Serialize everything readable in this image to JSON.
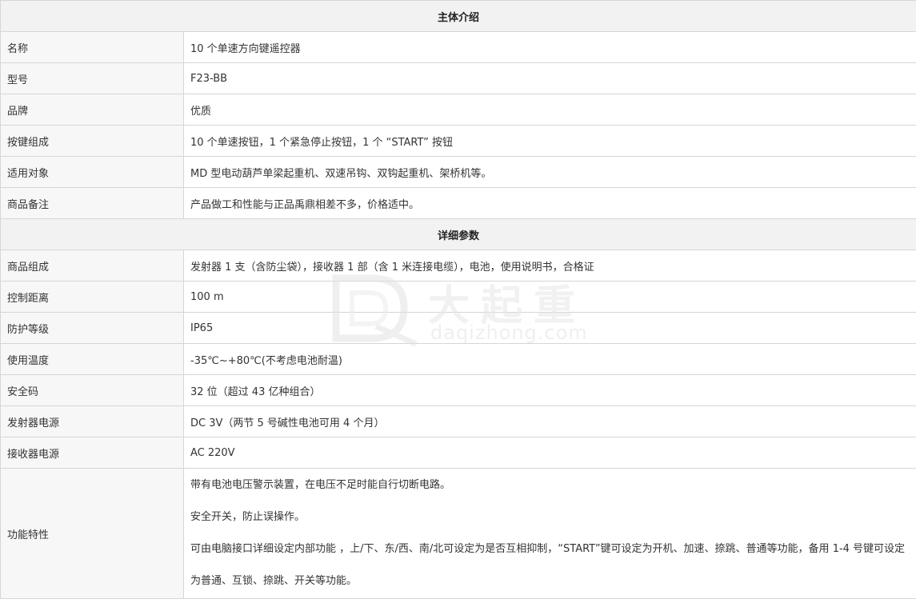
{
  "sections": [
    {
      "title": "主体介绍",
      "rows": [
        {
          "label": "名称",
          "value": "10 个单速方向键遥控器"
        },
        {
          "label": "型号",
          "value": "F23-BB"
        },
        {
          "label": "品牌",
          "value": "优质"
        },
        {
          "label": "按键组成",
          "value": "10 个单速按钮，1 个紧急停止按钮，1 个 “START” 按钮"
        },
        {
          "label": "适用对象",
          "value": "MD 型电动葫芦单梁起重机、双速吊钩、双钩起重机、架桥机等。"
        },
        {
          "label": "商品备注",
          "value": "产品做工和性能与正品禹鼎相差不多，价格适中。"
        }
      ]
    },
    {
      "title": "详细参数",
      "rows": [
        {
          "label": "商品组成",
          "value": "发射器 1 支（含防尘袋），接收器 1 部（含 1 米连接电缆），电池，使用说明书，合格证"
        },
        {
          "label": "控制距离",
          "value": "100 m"
        },
        {
          "label": "防护等级",
          "value": "IP65"
        },
        {
          "label": "使用温度",
          "value": "-35℃~+80℃(不考虑电池耐温)"
        },
        {
          "label": "安全码",
          "value": "32 位（超过 43 亿种组合）"
        },
        {
          "label": "发射器电源",
          "value": "DC 3V（两节 5 号碱性电池可用 4 个月）"
        },
        {
          "label": "接收器电源",
          "value": "AC 220V"
        }
      ],
      "features": {
        "label": "功能特性",
        "lines": [
          "带有电池电压警示装置，在电压不足时能自行切断电路。",
          "安全开关，防止误操作。",
          "可由电脑接口详细设定内部功能 ，上/下、东/西、南/北可设定为是否互相抑制，“START”键可设定为开机、加速、捺跳、普通等功能，备用 1-4 号键可设定为普通、互锁、捺跳、开关等功能。"
        ]
      }
    }
  ],
  "watermark": {
    "name": "大起重",
    "url": "daqizhong.com"
  }
}
